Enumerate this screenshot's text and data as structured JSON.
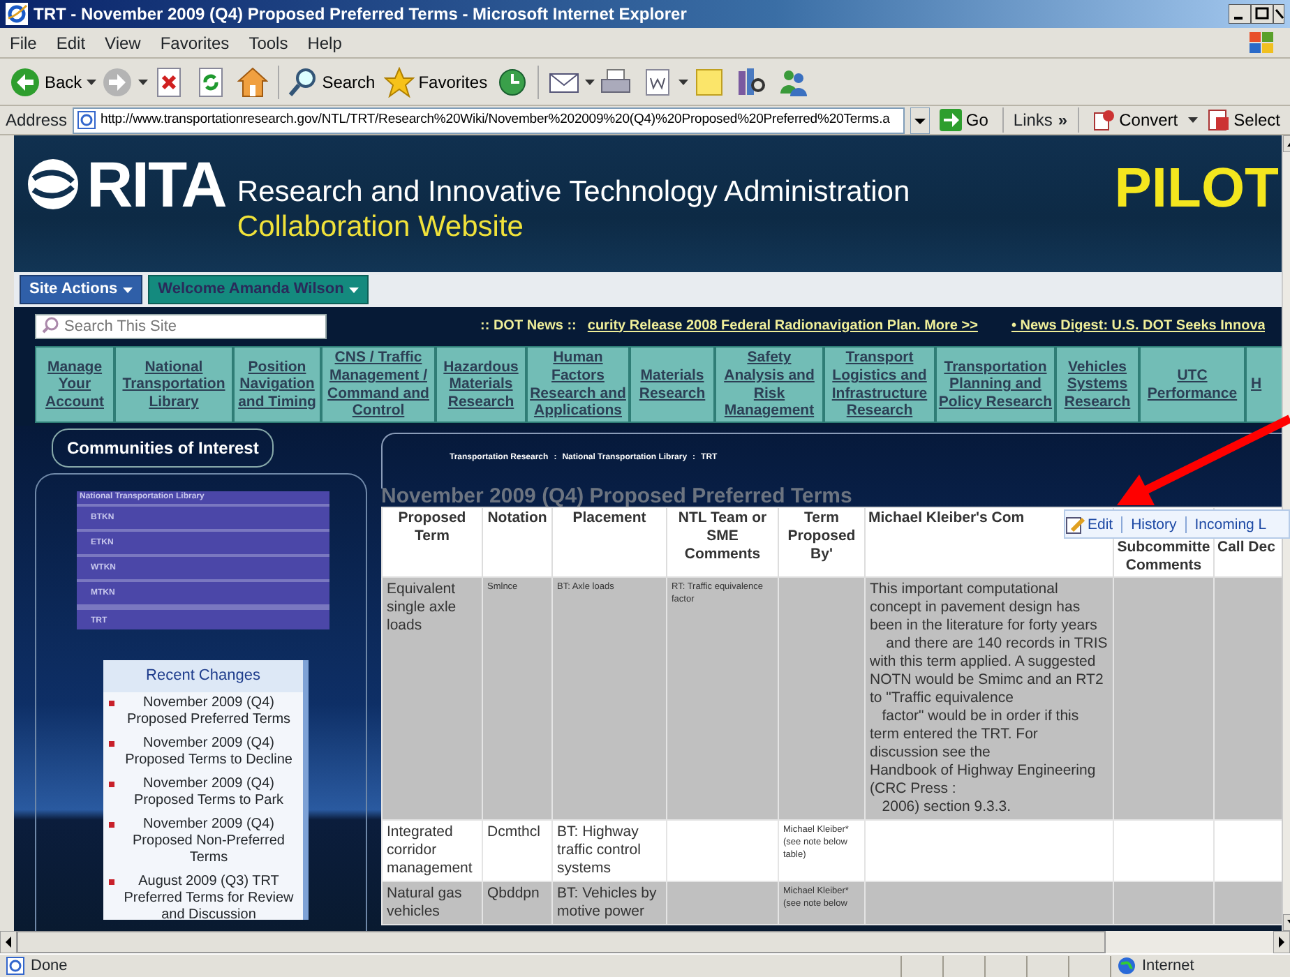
{
  "window": {
    "title": "TRT - November 2009 (Q4) Proposed Preferred Terms - Microsoft Internet Explorer"
  },
  "menu": [
    "File",
    "Edit",
    "View",
    "Favorites",
    "Tools",
    "Help"
  ],
  "toolbar": [
    {
      "kind": "back",
      "label": "Back"
    },
    {
      "kind": "forward"
    },
    {
      "kind": "stop"
    },
    {
      "kind": "refresh"
    },
    {
      "kind": "home"
    },
    {
      "kind": "search",
      "label": "Search"
    },
    {
      "kind": "favorites",
      "label": "Favorites"
    },
    {
      "kind": "history"
    },
    {
      "kind": "mail"
    },
    {
      "kind": "print"
    },
    {
      "kind": "word"
    },
    {
      "kind": "note"
    },
    {
      "kind": "research"
    },
    {
      "kind": "messenger"
    }
  ],
  "address_bar": {
    "label": "Address",
    "url": "http://www.transportationresearch.gov/NTL/TRT/Research%20Wiki/November%202009%20(Q4)%20Proposed%20Preferred%20Terms.a",
    "go": "Go",
    "links": "Links",
    "links_more": "»",
    "convert": "Convert",
    "select": "Select"
  },
  "header": {
    "logo": "RITA",
    "org": "Research and Innovative Technology Administration",
    "subtitle": "Collaboration Website",
    "badge": "PILOT"
  },
  "site_actions": "Site Actions",
  "welcome": "Welcome Amanda Wilson",
  "search": {
    "placeholder": "Search This Site"
  },
  "ticker": {
    "label": ":: DOT News ::",
    "items": [
      "curity Release 2008 Federal Radionavigation Plan.  More >>",
      "• News Digest: U.S. DOT Seeks Innova"
    ]
  },
  "nav_tiles": [
    "Manage Your Account",
    "National Transportation Library",
    "Position Navigation and Timing",
    "CNS / Traffic Management / Command and Control",
    "Hazardous Materials Research",
    "Human Factors Research and Applications",
    "Materials Research",
    "Safety Analysis and Risk Management",
    "Transport Logistics and Infrastructure Research",
    "Transportation Planning and Policy Research",
    "Vehicles Systems Research",
    "UTC Performance",
    "H"
  ],
  "sidebar": {
    "heading": "Communities of Interest",
    "nav_title": "National Transportation Library",
    "nav_items": [
      "BTKN",
      "ETKN",
      "WTKN",
      "MTKN",
      "TRT"
    ],
    "recent_changes": {
      "title": "Recent Changes",
      "items": [
        "November 2009 (Q4) Proposed Preferred Terms",
        "November 2009 (Q4) Proposed Terms to Decline",
        "November 2009 (Q4) Proposed Terms to Park",
        "November 2009 (Q4) Proposed Non-Preferred Terms",
        "August 2009 (Q3) TRT Preferred Terms for Review and Discussion"
      ]
    }
  },
  "breadcrumb": {
    "items": [
      "Transportation Research",
      "National Transportation Library",
      "TRT"
    ],
    "separator": ":"
  },
  "page_title": "November 2009 (Q4) Proposed Preferred Terms",
  "edit_toolbar": [
    "Edit",
    "History",
    "Incoming L"
  ],
  "table": {
    "columns": [
      "Proposed Term",
      "Notation",
      "Placement",
      "NTL Team or SME Comments",
      "Term Proposed By'",
      "Michael Kleiber's Com",
      "Subcommitte Comments",
      "Call Dec"
    ],
    "rows": [
      {
        "cells": [
          {
            "text": "Equivalent single axle loads"
          },
          {
            "text": "Smlnce",
            "kind": "fine"
          },
          {
            "text": "BT: Axle loads",
            "kind": "fine"
          },
          {
            "text": "RT: Traffic equivalence factor",
            "kind": "fine"
          },
          null,
          {
            "text": "This important computational concept in pavement design has been in the literature for forty years\n    and there are 140 records in TRIS with this term applied. A suggested NOTN would be Smimc and an RT2 to \"Traffic equivalence\n   factor\" would be in order if this term entered the TRT. For discussion see the ",
            "link": "Handbook of Highway Engineering",
            "after": " (CRC Press :\n   2006) section 9.3.3."
          },
          null,
          null
        ]
      },
      {
        "cells": [
          {
            "text": "Integrated corridor management"
          },
          {
            "text": "Dcmthcl"
          },
          {
            "text": "BT: Highway traffic control systems"
          },
          null,
          {
            "text": "Michael Kleiber* (see note below table)",
            "kind": "fine"
          },
          null,
          null,
          null
        ]
      },
      {
        "cells": [
          {
            "text": "Natural gas vehicles"
          },
          {
            "text": "Qbddpn"
          },
          {
            "text": "BT: Vehicles by motive power"
          },
          null,
          {
            "text": "Michael Kleiber* (see note below",
            "kind": "fine"
          },
          null,
          null,
          null
        ]
      }
    ]
  },
  "status_bar": {
    "text": "Done",
    "zone": "Internet"
  }
}
